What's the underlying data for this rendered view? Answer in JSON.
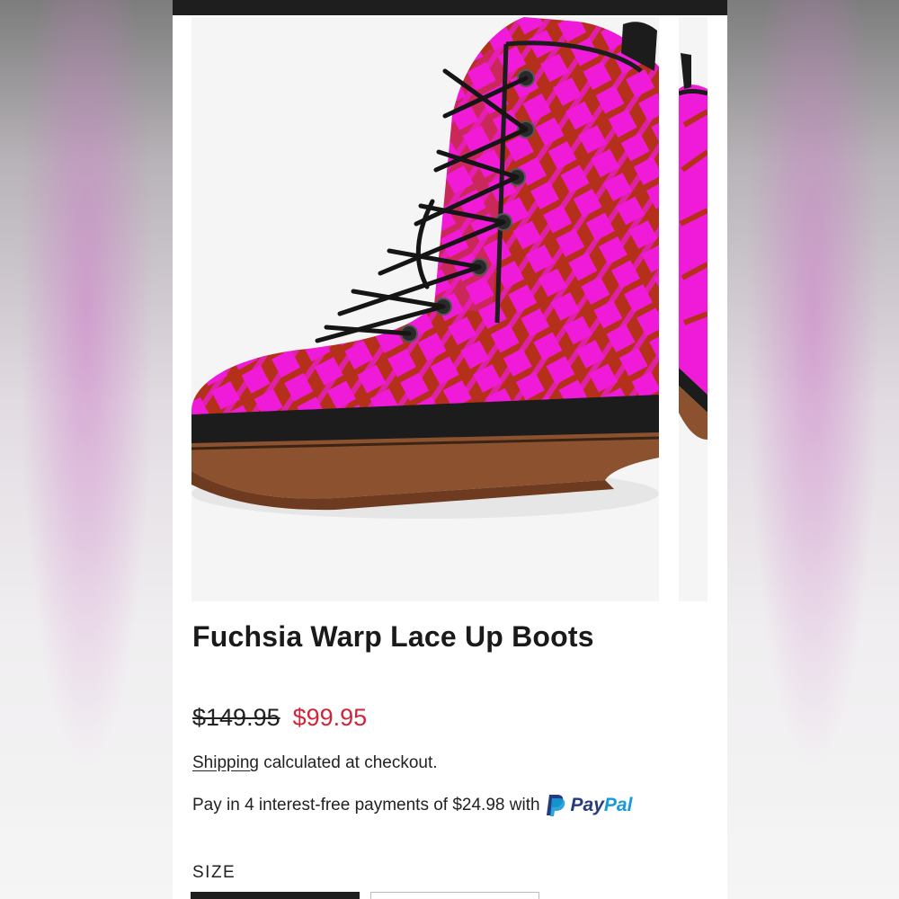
{
  "product": {
    "title": "Fuchsia Warp Lace Up Boots",
    "price_original": "$149.95",
    "price_sale": "$99.95",
    "shipping_link": "Shipping",
    "shipping_rest": "calculated at checkout.",
    "paypal_text": "Pay in 4 interest-free payments of $24.98 with",
    "paypal_brand_pay": "Pay",
    "paypal_brand_pal": "Pal"
  },
  "size": {
    "label": "SIZE",
    "options": [
      "",
      ""
    ]
  },
  "icons": {
    "paypal": "paypal-icon"
  },
  "colors": {
    "sale_price": "#d0263a",
    "boot_pink": "#f01bd8",
    "boot_red": "#b5301a",
    "paypal_dark": "#253b80",
    "paypal_light": "#179bd7"
  }
}
